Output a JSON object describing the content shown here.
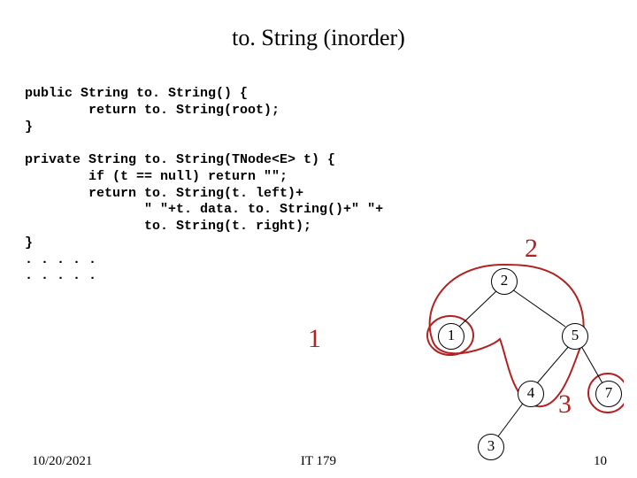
{
  "title": "to. String (inorder)",
  "code_lines": [
    "public String to. String() {",
    "        return to. String(root);",
    "}",
    "",
    "private String to. String(TNode<E> t) {",
    "        if (t == null) return \"\";",
    "        return to. String(t. left)+",
    "               \" \"+t. data. to. String()+\" \"+",
    "               to. String(t. right);",
    "}",
    ". . . . .",
    ". . . . ."
  ],
  "big_labels": {
    "one": "1",
    "two": "2",
    "three": "3"
  },
  "tree": {
    "n2": "2",
    "n1": "1",
    "n5": "5",
    "n4": "4",
    "n7": "7",
    "n3": "3"
  },
  "footer": {
    "date": "10/20/2021",
    "center": "IT 179",
    "page": "10"
  },
  "chart_data": {
    "type": "diagram",
    "note": "binary tree with recursion-call groupings",
    "nodes": [
      {
        "id": 2,
        "children": [
          1,
          5
        ]
      },
      {
        "id": 1,
        "children": []
      },
      {
        "id": 5,
        "children": [
          4,
          7
        ]
      },
      {
        "id": 4,
        "children": [
          3
        ]
      },
      {
        "id": 7,
        "children": []
      },
      {
        "id": 3,
        "children": []
      }
    ],
    "groups": [
      {
        "label": "1",
        "contains": [
          1
        ]
      },
      {
        "label": "2",
        "contains": [
          2,
          1,
          5,
          4
        ]
      },
      {
        "label": "3",
        "contains": [
          7
        ]
      }
    ]
  }
}
